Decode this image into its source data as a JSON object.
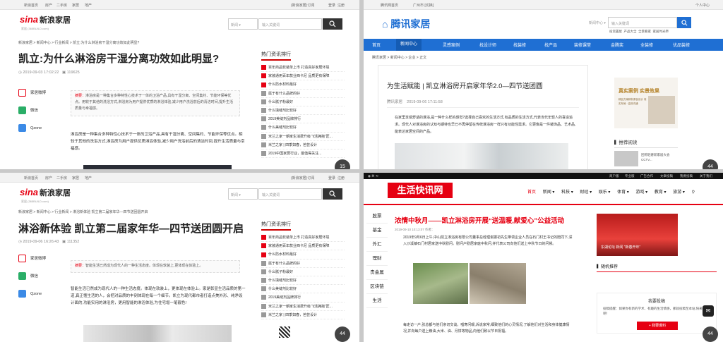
{
  "q1": {
    "topbar": {
      "left": [
        "新浪首页",
        "房产",
        "二手房",
        "家居",
        "地产"
      ],
      "right": [
        "(新浪家居)订阅",
        "登录",
        "注册"
      ]
    },
    "logo_brand": "sina",
    "logo_text": "新浪家居",
    "logo_sub": "家居 (365BUILD.com)",
    "search_select": "新闻",
    "search_placeholder": "输入关键词",
    "breadcrumb": "新浪家居 > 新闻中心 > 行业新闻 > 凯立:为什么淋浴房干湿分离功效如此明显?",
    "title": "凯立:为什么淋浴房干湿分离功效如此明显?",
    "date": "2019-09-03 17:02:22",
    "views": "119625",
    "share": [
      "家居微博",
      "微信",
      "Qzone"
    ],
    "summary_label": "摘要：",
    "summary": "淋浴房是一种集合多种特性心技术于一体的卫浴产品,具有干湿分离、空间集约、节能环保等优点。用较于其他的洗浴方式,淋浴房为用户提供优质的淋浴体验,减少用户洗浴前后的清洁时间,提升生活质量与幸福感。",
    "para": "淋浴房是一种集合多种特性心技术于一体的卫浴产品,具有干湿分离、空间集约、节能环保等优点。相较于其他的洗浴方式,淋浴房为用户提供优质淋浴体验,减少用户洗浴前后的清洁时间,提升生活质量与幸福感。",
    "side_title": "热门资讯排行",
    "rank": [
      "百年商品软装单上市 打造高好家居环境",
      "家装通用百年款业西卡尼 品质更有保障",
      "什么防水材料最好",
      "属于有什么品牌的好",
      "什么腻子粉最好",
      "什么填缝剂比较好",
      "2019美缝剂品牌排行",
      "什么美缝剂比较好",
      "米兰之家一朝家生消费升级飞活拥抱“匠...",
      "米兰之家 | 四季如春，芭芸设计",
      "2019中国家居行业，最值得关注..."
    ],
    "badge": "15"
  },
  "q2": {
    "topbar": {
      "left": [
        "腾讯网首页"
      ],
      "loc": "广州市 [切换]",
      "right": "个人中心"
    },
    "logo_text": "腾讯家居",
    "search_select": "新闻中心",
    "search_placeholder": "输入关键词",
    "sub_links": [
      "投资置屋",
      "产品大全",
      "全景看家",
      "家居时光帝"
    ],
    "nav": [
      "首页",
      "新闻中心",
      "灵感案例",
      "找设计师",
      "找装修",
      "找产品",
      "装修课堂",
      "金腾奖",
      "全装修",
      "优品装修"
    ],
    "nav_active": 1,
    "breadcrumb": "腾讯家居 > 新闻中心 > 企业 > 正文",
    "title": "为生活赋能 | 凯立淋浴房开启家年华2.0—四节送团圆",
    "source": "腾讯家居",
    "date": "2019-09-06 17:11:58",
    "para": "在家里享受舒适的淋浴,是一种什么样的感觉?选择自己喜欢的生活方式,有品质的生活方式,代表当代年轻人的喜造追求。现代人对淋浴房的认知与期待也早已不再停留在传统淋浴房一样只有功能性需求。它更像是一件装饰品、艺术品,能表达家居空间的产品。",
    "ad_title": "真实案例 实景效果",
    "ad_text": "精品方案精析原创设计 真实布局 · 高效沟通",
    "recommend": "推荐阅读",
    "rec_text": "团购轻奢新家居大会 CCTV...",
    "badge": "44"
  },
  "q3": {
    "topbar": {
      "left": [
        "新浪首页",
        "房产",
        "二手房",
        "家居",
        "地产"
      ],
      "right": [
        "(新浪家居)订阅",
        "登录",
        "注册"
      ]
    },
    "logo_brand": "sina",
    "logo_text": "新浪家居",
    "logo_sub": "家居 (365BUILD.com)",
    "search_select": "新闻",
    "search_placeholder": "输入关键词",
    "breadcrumb": "新浪家居 > 新闻中心 > 行业新闻 > 淋浴新体验 凯立第二届家年华—四节送团圆开启",
    "title": "淋浴新体验 凯立第二届家年华—四节送团圆开启",
    "date": "2019-09-06 16:26:43",
    "views": "111352",
    "share": [
      "家居微博",
      "微信",
      "Qzone"
    ],
    "summary_label": "摘要：",
    "summary": "智能生活已然成为现代人的一种生活态度。体现在软装上,更体现在体验上。",
    "para": "智能生活已然成为现代人的一种生活态度。体现在软装上，更体现在体验上。家是彰显生活品质的第一道,真正惬生活的人，会把对品质的丰刻体现在每一个细节。凯立为现代都市者打造点美外形、纯净设计面的,功能实用的淋浴房，更用智能的淋浴体验,为住宅增一笔靓色!",
    "side_title": "热门资讯排行",
    "rank": [
      "百年商品软装单上市 打造高好家居环境",
      "家装通用百年款业西卡尼 品质更有保障",
      "什么防水材料最好",
      "属于有什么品牌的好",
      "什么腻子粉最好",
      "什么填缝剂比较好",
      "什么美缝剂比较好",
      "2019美缝剂品牌排行",
      "米兰之家一朝家生消费升级飞活拥抱“匠...",
      "米兰之家 | 四季如春，芭芸设计"
    ],
    "badge": "44"
  },
  "q4": {
    "topbar_right": [
      "商户版",
      "专业版",
      "广告合作",
      "文章投稿",
      "我要投稿",
      "关于我们"
    ],
    "logo_text": "生活快讯网",
    "nav": [
      "首页",
      "新闻 ▾",
      "科技 ▾",
      "财经 ▾",
      "娱乐 ▾",
      "体育 ▾",
      "游戏 ▾",
      "教育 ▾",
      "旅游 ▾"
    ],
    "cats": [
      "股票",
      "基金",
      "外汇",
      "理财",
      "贵金属",
      "区块链",
      "生活"
    ],
    "title": "浓情中秋月——凯立淋浴房开展“送温暖,献爱心”公益活动",
    "date": "2019-09-10 10:13:07 作者：",
    "para": "2019年9月6日上午,中山凯立淋浴房有限公司董事总经理谢振初先生带领企业人员在石门村王书记的陪同下,深入沙溪镇石门村居家送中秋慰问。慰问户慰居家庭中秋问,并代表公司向他们送上中秋节日的问候。",
    "para2": "每走访一户,张总都与他们亲切交谈。嘘寒问暖,诉说家常,细致他们的心灵情况,了解他们对生活和身体健康情况,并向每户送上粮油,大米、油、月饼等物品,向他们致以节日祝福。",
    "right_banner_caption": "东湖论坛 新闻 “新春开年”",
    "right_heading": "随机推荐",
    "contrib_title": "我要投稿",
    "contrib_text": "投稿提醒：如果你有新的学术、有趣的生活情感，那就投稿至本站,快来投稿吧！",
    "contrib_btn": "+ 我要爆料",
    "badge": "44"
  }
}
